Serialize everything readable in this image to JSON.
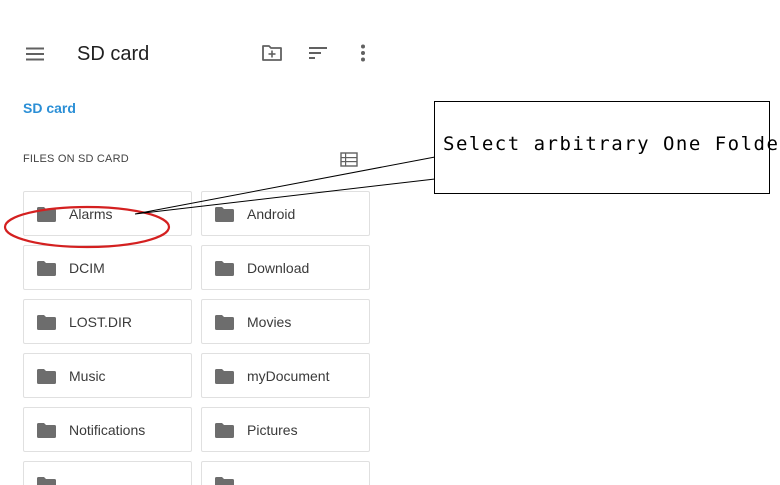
{
  "appbar": {
    "title": "SD card",
    "menu_icon": "hamburger-menu-icon",
    "new_folder_icon": "create-folder-icon",
    "sort_icon": "sort-icon",
    "more_icon": "more-vert-icon"
  },
  "breadcrumb": {
    "label": "SD card"
  },
  "section": {
    "title": "FILES ON SD CARD",
    "view_toggle_icon": "list-view-icon"
  },
  "folders": [
    {
      "name": "Alarms"
    },
    {
      "name": "Android"
    },
    {
      "name": "DCIM"
    },
    {
      "name": "Download"
    },
    {
      "name": "LOST.DIR"
    },
    {
      "name": "Movies"
    },
    {
      "name": "Music"
    },
    {
      "name": "myDocument"
    },
    {
      "name": "Notifications"
    },
    {
      "name": "Pictures"
    },
    {
      "name": ""
    },
    {
      "name": ""
    }
  ],
  "annotation": {
    "text": "Select arbitrary One Folder"
  },
  "colors": {
    "accent": "#2b8fd6",
    "icon": "#616161",
    "folder_icon": "#6d6d6d",
    "annotation_ring": "#d42020",
    "cell_border": "#e0e0e0"
  }
}
